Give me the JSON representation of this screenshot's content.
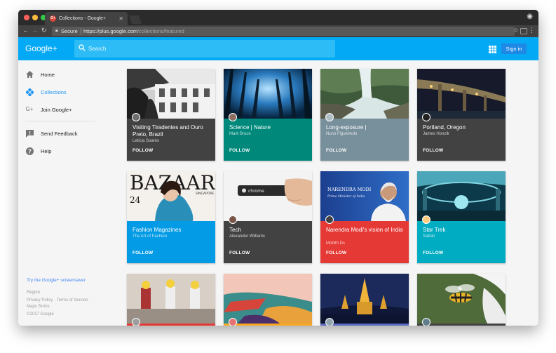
{
  "browser": {
    "tab_title": "Collections - Google+",
    "tab_favicon": "G+",
    "secure_label": "Secure",
    "url_host": "https://plus.google.com",
    "url_path": "/collections/featured"
  },
  "header": {
    "logo": "Google+",
    "search_placeholder": "Search",
    "signin_label": "Sign in",
    "accent": "#03a9f4"
  },
  "sidebar": {
    "items": [
      {
        "label": "Home",
        "icon": "home-icon"
      },
      {
        "label": "Collections",
        "icon": "collections-icon",
        "active": true
      },
      {
        "label": "Join Google+",
        "icon": "google-plus-icon"
      },
      {
        "label": "Send Feedback",
        "icon": "feedback-icon"
      },
      {
        "label": "Help",
        "icon": "help-icon"
      }
    ],
    "screensaver_link": "Try the Google+ screensaver",
    "region": "Region",
    "legal_1": "Privacy Policy · Terms of Service ·",
    "legal_2": "Maps Terms",
    "copyright": "©2017 Google"
  },
  "collections": [
    {
      "title": "Visiting Tiradentes and Ouro Preto, Brazil",
      "author": "Leticia Soares",
      "follow": "FOLLOW",
      "color": "#424242"
    },
    {
      "title": "Science | Nature",
      "author": "Mark Bruce",
      "follow": "FOLLOW",
      "color": "#00897b"
    },
    {
      "title": "Long-exposure |",
      "author": "Nuno Figueiredo",
      "follow": "FOLLOW",
      "color": "#78909c"
    },
    {
      "title": "Portland, Oregon",
      "author": "James Honzik",
      "follow": "FOLLOW",
      "color": "#424242"
    },
    {
      "title": "Fashion Magazines",
      "author": "The Art of Fashion",
      "follow": "FOLLOW",
      "color": "#039be5"
    },
    {
      "title": "Tech",
      "author": "Alexander Williams",
      "follow": "FOLLOW",
      "color": "#424242"
    },
    {
      "title": "Narendra Modi's vision of India",
      "author": "Mohith Ds",
      "follow": "FOLLOW",
      "color": "#e53935"
    },
    {
      "title": "Star Trek",
      "author": "Sabah",
      "follow": "FOLLOW",
      "color": "#00acc1"
    },
    {
      "color": "#e53935"
    },
    {
      "color": "#f9a825"
    },
    {
      "color": "#5c6bc0"
    },
    {
      "color": "#424242"
    }
  ],
  "image_text": {
    "bazaar": "BAZAAR",
    "bazaar_sub": "SINGAPORE",
    "chrome": "chrome",
    "modi_name": "NARENDRA MODI",
    "modi_sub": "Prime Minister of India"
  }
}
